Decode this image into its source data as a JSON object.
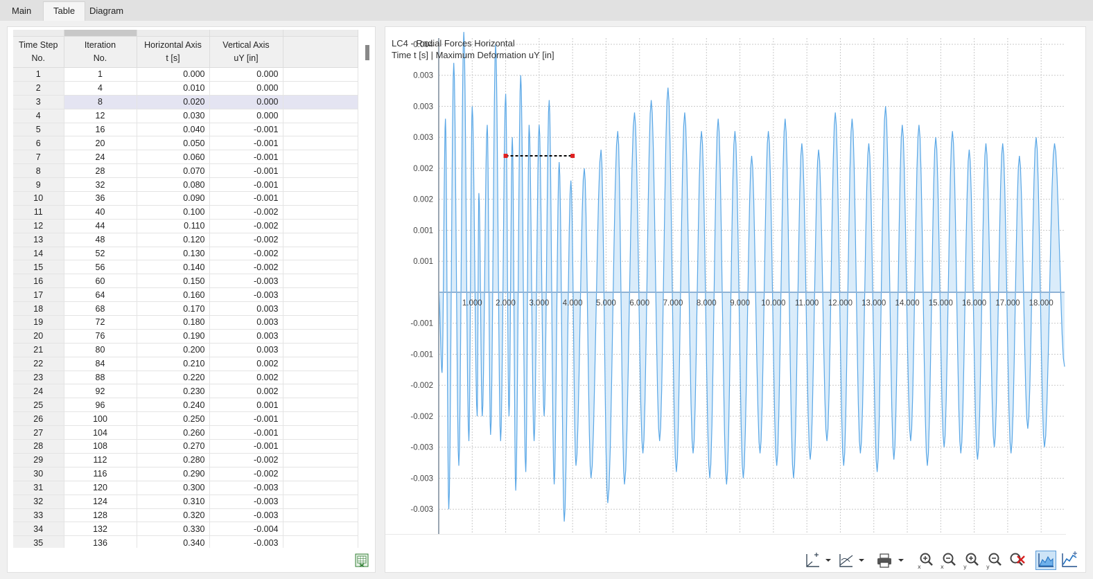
{
  "tabs": [
    {
      "label": "Main",
      "active": false
    },
    {
      "label": "Table",
      "active": true
    },
    {
      "label": "Diagram",
      "active": false
    }
  ],
  "table": {
    "headers": [
      [
        "Time Step",
        "No."
      ],
      [
        "Iteration",
        "No."
      ],
      [
        "Horizontal Axis",
        "t [s]"
      ],
      [
        "Vertical Axis",
        "uY [in]"
      ]
    ],
    "selected_row": 3,
    "rows": [
      [
        "1",
        "1",
        "0.000",
        "0.000"
      ],
      [
        "2",
        "4",
        "0.010",
        "0.000"
      ],
      [
        "3",
        "8",
        "0.020",
        "0.000"
      ],
      [
        "4",
        "12",
        "0.030",
        "0.000"
      ],
      [
        "5",
        "16",
        "0.040",
        "-0.001"
      ],
      [
        "6",
        "20",
        "0.050",
        "-0.001"
      ],
      [
        "7",
        "24",
        "0.060",
        "-0.001"
      ],
      [
        "8",
        "28",
        "0.070",
        "-0.001"
      ],
      [
        "9",
        "32",
        "0.080",
        "-0.001"
      ],
      [
        "10",
        "36",
        "0.090",
        "-0.001"
      ],
      [
        "11",
        "40",
        "0.100",
        "-0.002"
      ],
      [
        "12",
        "44",
        "0.110",
        "-0.002"
      ],
      [
        "13",
        "48",
        "0.120",
        "-0.002"
      ],
      [
        "14",
        "52",
        "0.130",
        "-0.002"
      ],
      [
        "15",
        "56",
        "0.140",
        "-0.002"
      ],
      [
        "16",
        "60",
        "0.150",
        "-0.003"
      ],
      [
        "17",
        "64",
        "0.160",
        "-0.003"
      ],
      [
        "18",
        "68",
        "0.170",
        "0.003"
      ],
      [
        "19",
        "72",
        "0.180",
        "0.003"
      ],
      [
        "20",
        "76",
        "0.190",
        "0.003"
      ],
      [
        "21",
        "80",
        "0.200",
        "0.003"
      ],
      [
        "22",
        "84",
        "0.210",
        "0.002"
      ],
      [
        "23",
        "88",
        "0.220",
        "0.002"
      ],
      [
        "24",
        "92",
        "0.230",
        "0.002"
      ],
      [
        "25",
        "96",
        "0.240",
        "0.001"
      ],
      [
        "26",
        "100",
        "0.250",
        "-0.001"
      ],
      [
        "27",
        "104",
        "0.260",
        "-0.001"
      ],
      [
        "28",
        "108",
        "0.270",
        "-0.001"
      ],
      [
        "29",
        "112",
        "0.280",
        "-0.002"
      ],
      [
        "30",
        "116",
        "0.290",
        "-0.002"
      ],
      [
        "31",
        "120",
        "0.300",
        "-0.003"
      ],
      [
        "32",
        "124",
        "0.310",
        "-0.003"
      ],
      [
        "33",
        "128",
        "0.320",
        "-0.003"
      ],
      [
        "34",
        "132",
        "0.330",
        "-0.004"
      ],
      [
        "35",
        "136",
        "0.340",
        "-0.003"
      ]
    ]
  },
  "chart": {
    "title_line1": "LC4 - Radial Forces Horizontal",
    "title_line2": "Time t [s] | Maximum Deformation uY [in]"
  },
  "chart_data": {
    "type": "area",
    "title": "LC4 - Radial Forces Horizontal",
    "subtitle": "Time t [s] | Maximum Deformation uY [in]",
    "xlabel": "",
    "ylabel": "",
    "x_ticks": [
      "1.000",
      "2.000",
      "3.000",
      "4.000",
      "5.000",
      "6.000",
      "7.000",
      "8.000",
      "9.000",
      "10.000",
      "11.000",
      "12.000",
      "13.000",
      "14.000",
      "15.000",
      "16.000",
      "17.000",
      "18.000"
    ],
    "y_tick_labels": [
      {
        "value": 0.004,
        "label": "0.004"
      },
      {
        "value": 0.0035,
        "label": "0.003"
      },
      {
        "value": 0.003,
        "label": "0.003"
      },
      {
        "value": 0.0025,
        "label": "0.003"
      },
      {
        "value": 0.002,
        "label": "0.002"
      },
      {
        "value": 0.0015,
        "label": "0.002"
      },
      {
        "value": 0.001,
        "label": "0.001"
      },
      {
        "value": 0.0005,
        "label": "0.001"
      },
      {
        "value": -0.0005,
        "label": "-0.001"
      },
      {
        "value": -0.001,
        "label": "-0.001"
      },
      {
        "value": -0.0015,
        "label": "-0.002"
      },
      {
        "value": -0.002,
        "label": "-0.002"
      },
      {
        "value": -0.0025,
        "label": "-0.003"
      },
      {
        "value": -0.003,
        "label": "-0.003"
      },
      {
        "value": -0.0035,
        "label": "-0.003"
      }
    ],
    "xlim": [
      0,
      18.7
    ],
    "ylim": [
      -0.0039,
      0.0041
    ],
    "grid": true,
    "series": [
      {
        "color": "#5aa7e6",
        "fill": "#d6eaf9",
        "peaks": [
          [
            0.0,
            0.0
          ],
          [
            0.1,
            -0.0013
          ],
          [
            0.2,
            0.0028
          ],
          [
            0.3,
            -0.0035
          ],
          [
            0.45,
            0.0037
          ],
          [
            0.6,
            -0.0028
          ],
          [
            0.75,
            0.0042
          ],
          [
            0.9,
            -0.0024
          ],
          [
            1.0,
            0.003
          ],
          [
            1.15,
            -0.002
          ],
          [
            1.2,
            0.0016
          ],
          [
            1.3,
            -0.002
          ],
          [
            1.45,
            0.0027
          ],
          [
            1.55,
            -0.0023
          ],
          [
            1.7,
            0.004
          ],
          [
            1.85,
            -0.0024
          ],
          [
            2.0,
            0.0032
          ],
          [
            2.1,
            -0.002
          ],
          [
            2.2,
            0.0025
          ],
          [
            2.3,
            -0.0032
          ],
          [
            2.45,
            0.0035
          ],
          [
            2.6,
            -0.0029
          ],
          [
            2.7,
            0.0027
          ],
          [
            2.85,
            -0.0024
          ],
          [
            3.0,
            0.0027
          ],
          [
            3.15,
            -0.002
          ],
          [
            3.3,
            0.0031
          ],
          [
            3.45,
            -0.0031
          ],
          [
            3.6,
            0.0021
          ],
          [
            3.75,
            -0.0037
          ],
          [
            3.95,
            0.0018
          ],
          [
            4.1,
            -0.0028
          ],
          [
            4.35,
            0.002
          ],
          [
            4.55,
            -0.003
          ],
          [
            4.85,
            0.0023
          ],
          [
            5.05,
            -0.0034
          ],
          [
            5.35,
            0.0026
          ],
          [
            5.55,
            -0.0031
          ],
          [
            5.85,
            0.0029
          ],
          [
            6.1,
            -0.0026
          ],
          [
            6.35,
            0.0031
          ],
          [
            6.6,
            -0.0024
          ],
          [
            6.85,
            0.0033
          ],
          [
            7.1,
            -0.0029
          ],
          [
            7.35,
            0.0029
          ],
          [
            7.6,
            -0.0026
          ],
          [
            7.85,
            0.0026
          ],
          [
            8.1,
            -0.003
          ],
          [
            8.35,
            0.0028
          ],
          [
            8.6,
            -0.0031
          ],
          [
            8.85,
            0.0026
          ],
          [
            9.1,
            -0.003
          ],
          [
            9.35,
            0.0022
          ],
          [
            9.6,
            -0.0026
          ],
          [
            9.85,
            0.0026
          ],
          [
            10.1,
            -0.0028
          ],
          [
            10.35,
            0.0028
          ],
          [
            10.6,
            -0.003
          ],
          [
            10.85,
            0.0024
          ],
          [
            11.1,
            -0.0027
          ],
          [
            11.35,
            0.0023
          ],
          [
            11.6,
            -0.0024
          ],
          [
            11.85,
            0.0029
          ],
          [
            12.1,
            -0.0028
          ],
          [
            12.35,
            0.0028
          ],
          [
            12.6,
            -0.0026
          ],
          [
            12.85,
            0.0024
          ],
          [
            13.1,
            -0.0029
          ],
          [
            13.35,
            0.003
          ],
          [
            13.6,
            -0.0027
          ],
          [
            13.85,
            0.0027
          ],
          [
            14.1,
            -0.0024
          ],
          [
            14.35,
            0.0027
          ],
          [
            14.6,
            -0.0028
          ],
          [
            14.85,
            0.0025
          ],
          [
            15.1,
            -0.0025
          ],
          [
            15.35,
            0.0026
          ],
          [
            15.6,
            -0.0026
          ],
          [
            15.85,
            0.0023
          ],
          [
            16.1,
            -0.0027
          ],
          [
            16.35,
            0.0024
          ],
          [
            16.6,
            -0.0025
          ],
          [
            16.85,
            0.0024
          ],
          [
            17.1,
            -0.0026
          ],
          [
            17.35,
            0.0022
          ],
          [
            17.6,
            -0.0022
          ],
          [
            17.85,
            0.0025
          ],
          [
            18.1,
            -0.0025
          ],
          [
            18.4,
            0.0024
          ],
          [
            18.7,
            -0.0012
          ]
        ]
      }
    ],
    "marker_segment": {
      "x1": 2.0,
      "x2": 4.0,
      "y": 0.0022,
      "color": "#000000",
      "endpoint_color": "#e02020"
    }
  },
  "toolbar": {
    "buttons": [
      "axis-settings-icon",
      "tangent-icon",
      "print-icon",
      "zoom-in-x-icon",
      "zoom-out-x-icon",
      "zoom-in-y-icon",
      "zoom-out-y-icon",
      "reset-zoom-icon",
      "area-chart-icon",
      "line-chart-icon"
    ]
  }
}
